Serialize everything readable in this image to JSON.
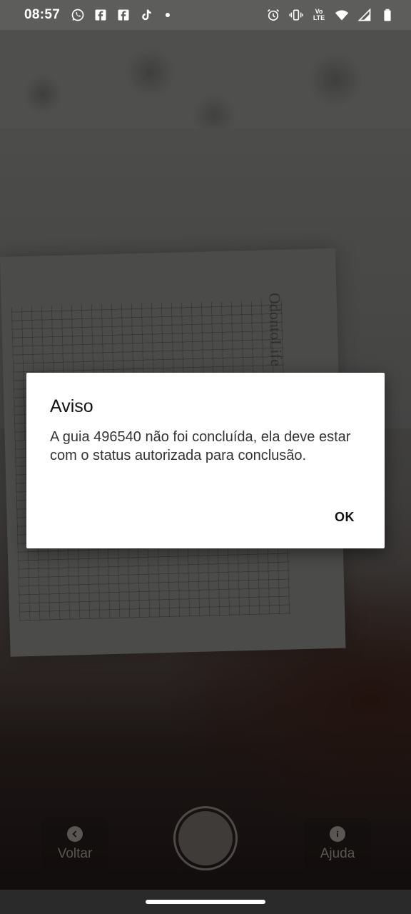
{
  "status_bar": {
    "time": "08:57",
    "left_icons": [
      "whatsapp-icon",
      "facebook-icon",
      "facebook-icon",
      "tiktok-icon",
      "notification-dot"
    ],
    "right_icons": [
      "alarm-icon",
      "vibrate-icon",
      "volte-icon",
      "wifi-icon",
      "signal-icon",
      "battery-icon"
    ],
    "volte_top": "Vo",
    "volte_bottom": "LTE"
  },
  "dialog": {
    "title": "Aviso",
    "message": "A guia 496540 não foi concluída, ela deve estar com o status autorizada para conclusão.",
    "ok_label": "OK"
  },
  "controls": {
    "back_label": "Voltar",
    "help_label": "Ajuda"
  },
  "colors": {
    "dialog_bg": "#ffffff",
    "status_bar_bg": "#5d5d5c",
    "nav_bar_bg": "#2b2a2a"
  }
}
